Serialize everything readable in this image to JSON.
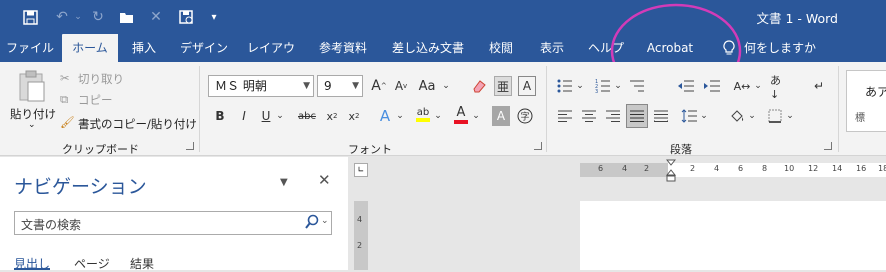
{
  "window": {
    "title": "文書 1 - Word"
  },
  "qat": {
    "icons": [
      "save-icon",
      "undo-icon",
      "redo-icon",
      "open-folder-icon",
      "close-icon",
      "print-preview-icon",
      "customize-icon"
    ]
  },
  "tabs": [
    "ファイル",
    "ホーム",
    "挿入",
    "デザイン",
    "レイアウト",
    "参考資料",
    "差し込み文書",
    "校閲",
    "表示",
    "ヘルプ",
    "Acrobat",
    "何をしますか"
  ],
  "clipboard": {
    "paste": "貼り付け",
    "cut": "切り取り",
    "copy": "コピー",
    "format_painter": "書式のコピー/貼り付け",
    "group_label": "クリップボード"
  },
  "font": {
    "name": "ＭＳ 明朝",
    "size": "9",
    "group_label": "フォント"
  },
  "paragraph": {
    "group_label": "段落"
  },
  "styles": {
    "preview": "あア",
    "preview2": "標"
  },
  "nav": {
    "title": "ナビゲーション",
    "search_placeholder": "文書の検索",
    "tabs": [
      "見出し",
      "ページ",
      "結果"
    ]
  },
  "ruler": {
    "left_ticks": [
      "6",
      "4",
      "2",
      "2",
      "4",
      "6",
      "8",
      "10",
      "12",
      "14",
      "16",
      "18"
    ],
    "vertical_ticks": [
      "4",
      "2"
    ]
  },
  "colors": {
    "accent": "#2b579a",
    "highlight": "#ffff00",
    "font_color": "#e81123",
    "annotation": "#d23bb8"
  }
}
